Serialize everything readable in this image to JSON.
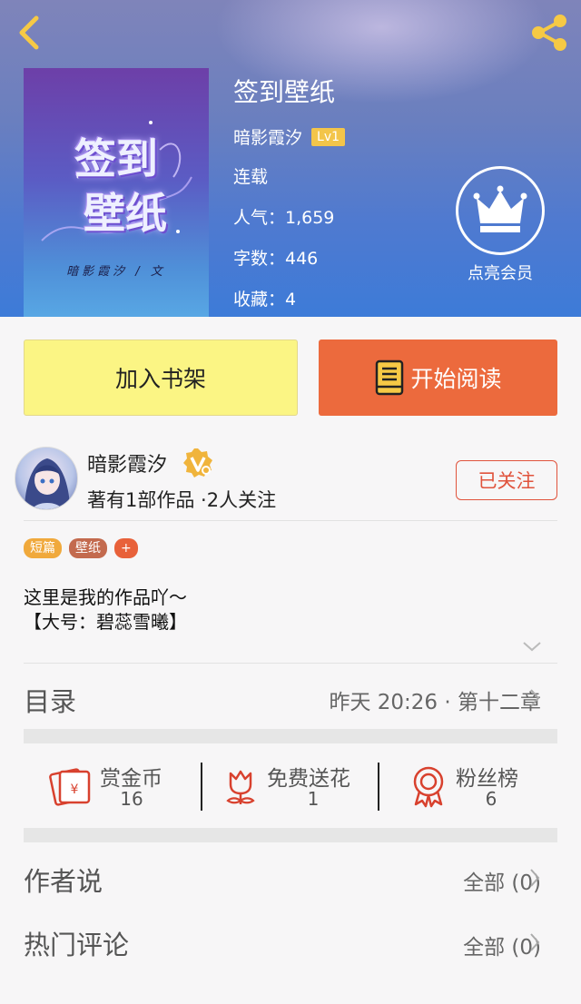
{
  "header": {
    "book_title": "签到壁纸",
    "author": "暗影霞汐",
    "author_level": "Lv1",
    "status": "连载",
    "popularity": "人气：1,659",
    "word_count": "字数：446",
    "favorites": "收藏：4",
    "vip_label": "点亮会员",
    "cover": {
      "title_line1": "签到",
      "title_line2": "壁纸",
      "author_signature": "暗影霞汐 / 文"
    }
  },
  "actions": {
    "add_shelf": "加入书架",
    "start_read": "开始阅读"
  },
  "author_card": {
    "name": "暗影霞汐",
    "stats": "著有1部作品 ·2人关注",
    "follow_label": "已关注"
  },
  "tags": [
    {
      "label": "短篇",
      "color": "#f0a93c"
    },
    {
      "label": "壁纸",
      "color": "#c36a4e"
    },
    {
      "label": "+",
      "color": "#e8613a"
    }
  ],
  "description": "这里是我的作品吖～\n【大号：碧蕊雪曦】",
  "toc": {
    "label": "目录",
    "latest": "昨天 20:26 · 第十二章"
  },
  "stats": [
    {
      "label": "赏金币",
      "value": "16",
      "icon": "red-envelope-icon"
    },
    {
      "label": "免费送花",
      "value": "1",
      "icon": "flower-icon"
    },
    {
      "label": "粉丝榜",
      "value": "6",
      "icon": "rank-medal-icon"
    }
  ],
  "sections": [
    {
      "label": "作者说",
      "right": "全部 (0)"
    },
    {
      "label": "热门评论",
      "right": "全部 (0)"
    }
  ],
  "colors": {
    "accent_orange": "#ec6a3d",
    "shelf_yellow": "#fbf584",
    "icon_red": "#d8412e",
    "back_yellow": "#f6c945"
  }
}
